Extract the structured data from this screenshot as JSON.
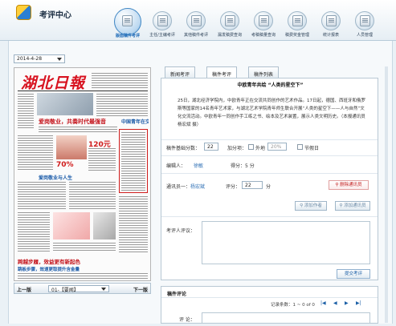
{
  "app": {
    "title": "考评中心"
  },
  "nav": {
    "items": [
      {
        "label": "版面稿件考评",
        "active": true
      },
      {
        "label": "主任/主编考评",
        "active": false
      },
      {
        "label": "其他稿件考评",
        "active": false
      },
      {
        "label": "漏发稿费查询",
        "active": false
      },
      {
        "label": "考稿稿量查询",
        "active": false
      },
      {
        "label": "稿费奖金管理",
        "active": false
      },
      {
        "label": "统计报表",
        "active": false
      },
      {
        "label": "人员管理",
        "active": false
      }
    ]
  },
  "date": {
    "value": "2014-4-28"
  },
  "newspaper": {
    "masthead": "湖北日報",
    "headlines": [
      "爱岗敬业，共奏时代最强音",
      "中国青年在交流",
      "爱岗敬业与人生",
      "跨越步履，效益更有新起色",
      "跳板步骤，效速更取提升含金量"
    ],
    "callouts": [
      "120元",
      "70%"
    ]
  },
  "pager": {
    "prev": "上一版",
    "page": "01-【要闻】",
    "next": "下一版"
  },
  "tabs": [
    {
      "label": "新闻考评",
      "active": false
    },
    {
      "label": "稿件考评",
      "active": true
    },
    {
      "label": "稿件列表",
      "active": false
    }
  ],
  "article": {
    "title": "中欧青年共绘  “人类的星空下”",
    "body": "25日，湖北经济学院内，中欧青年正在交流共同创作的艺术作品。17日起，德国、西班牙和俄罗斯等国家的14名青年艺术家，与湖北艺术学院青年师生联合开展“人类的星空下——人与自然”文化交流活动。中欧青年一同创作手工练之书、绘本及艺术装置，展示人类文明历史。（本报通讯员 杨宏斌 摄）"
  },
  "form": {
    "base_score_label": "稿件基础分数：",
    "base_score": "22",
    "bonus_label": "加分项：",
    "option_foreign": "外地",
    "option_foreign_value": "20%",
    "option_holiday": "节假日",
    "editor_label": "编辑人：",
    "editor_name": "徐敏",
    "editor_score": "得分：5 分",
    "reporter_label": "通讯员一：",
    "reporter_name": "杨宏斌",
    "reporter_score_label": "评分：",
    "reporter_score": "22",
    "reporter_unit": "分",
    "delete_reporter": "删除通讯员",
    "add_author": "添加作者",
    "add_reporter": "添加通讯员",
    "comment_label": "考评人评议：",
    "submit": "提交考评"
  },
  "comments": {
    "title": "稿件评论",
    "records": "记录条数：1 ~ 0 of 0",
    "first": "|◀",
    "prev": "◀",
    "next": "▶",
    "last": "▶|",
    "label": "评 论："
  }
}
